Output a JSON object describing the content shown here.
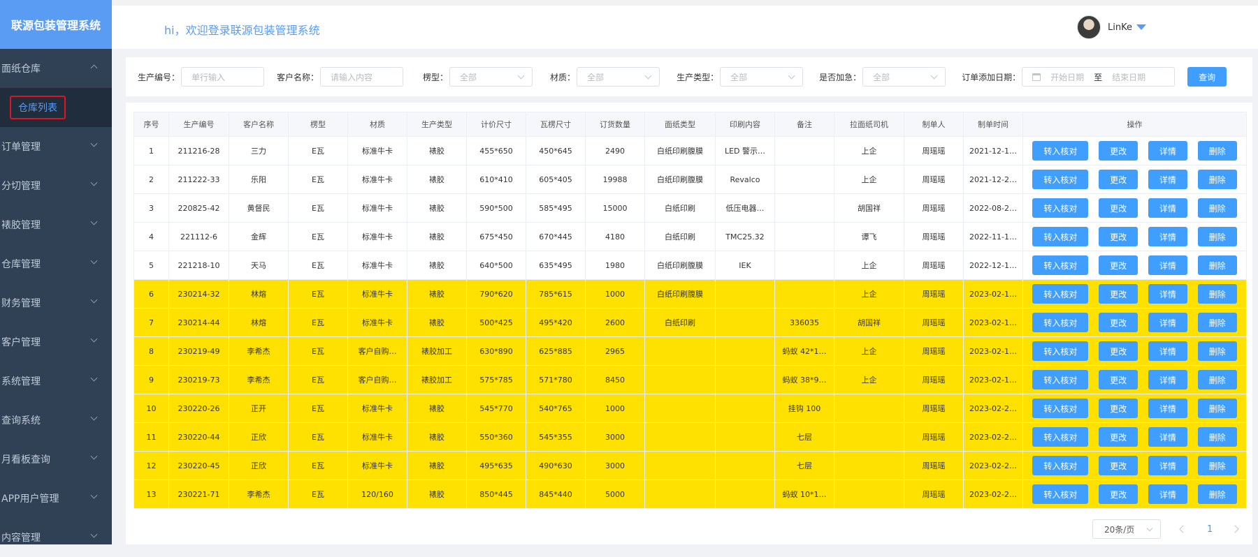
{
  "app": {
    "title": "联源包装管理系统"
  },
  "header": {
    "welcome": "hi，欢迎登录联源包装管理系统",
    "username": "LinKe"
  },
  "sidebar": {
    "open_group": "面纸仓库",
    "active_item": "仓库列表",
    "groups": [
      "订单管理",
      "分切管理",
      "裱胶管理",
      "仓库管理",
      "财务管理",
      "客户管理",
      "系统管理",
      "查询系统",
      "月看板查询",
      "APP用户管理",
      "内容管理"
    ]
  },
  "filters": {
    "prod_no_label": "生产编号：",
    "prod_no_placeholder": "单行输入",
    "customer_label": "客户名称：",
    "customer_placeholder": "请输入内容",
    "flute_label": "楞型：",
    "flute_value": "全部",
    "material_label": "材质：",
    "material_value": "全部",
    "prod_type_label": "生产类型：",
    "prod_type_value": "全部",
    "urgent_label": "是否加急：",
    "urgent_value": "全部",
    "date_label": "订单添加日期：",
    "start_placeholder": "开始日期",
    "to": "至",
    "end_placeholder": "结束日期",
    "query_label": "查询"
  },
  "table": {
    "headers": [
      "序号",
      "生产编号",
      "客户名称",
      "楞型",
      "材质",
      "生产类型",
      "计价尺寸",
      "瓦楞尺寸",
      "订货数量",
      "面纸类型",
      "印刷内容",
      "备注",
      "拉面纸司机",
      "制单人",
      "制单时间",
      "操作"
    ],
    "actions": [
      "转入核对",
      "更改",
      "详情",
      "删除"
    ],
    "rows": [
      {
        "hl": false,
        "cells": [
          "1",
          "211216-28",
          "三力",
          "E瓦",
          "标准牛卡",
          "裱胶",
          "455*650",
          "450*645",
          "2490",
          "白纸印刷腹膜",
          "LED 警示…",
          "",
          "上企",
          "周瑶瑶",
          "2021-12-1…"
        ]
      },
      {
        "hl": false,
        "cells": [
          "2",
          "211222-33",
          "乐阳",
          "E瓦",
          "标准牛卡",
          "裱胶",
          "610*410",
          "605*405",
          "19988",
          "白纸印刷腹膜",
          "Revalco",
          "",
          "上企",
          "周瑶瑶",
          "2021-12-2…"
        ]
      },
      {
        "hl": false,
        "cells": [
          "3",
          "220825-42",
          "黄督民",
          "E瓦",
          "标准牛卡",
          "裱胶",
          "590*500",
          "585*495",
          "15000",
          "白纸印刷",
          "低压电器…",
          "",
          "胡国祥",
          "周瑶瑶",
          "2022-08-2…"
        ]
      },
      {
        "hl": false,
        "cells": [
          "4",
          "221112-6",
          "金辉",
          "E瓦",
          "标准牛卡",
          "裱胶",
          "675*450",
          "670*445",
          "4180",
          "白纸印刷",
          "TMC25.32",
          "",
          "谭飞",
          "周瑶瑶",
          "2022-11-1…"
        ]
      },
      {
        "hl": false,
        "cells": [
          "5",
          "221218-10",
          "天马",
          "E瓦",
          "标准牛卡",
          "裱胶",
          "640*500",
          "635*495",
          "1980",
          "白纸印刷腹膜",
          "IEK",
          "",
          "上企",
          "周瑶瑶",
          "2022-12-1…"
        ]
      },
      {
        "hl": true,
        "cells": [
          "6",
          "230214-32",
          "林熔",
          "E瓦",
          "标准牛卡",
          "裱胶",
          "790*620",
          "785*615",
          "1000",
          "白纸印刷腹膜",
          "",
          "",
          "上企",
          "周瑶瑶",
          "2023-02-1…"
        ]
      },
      {
        "hl": true,
        "cells": [
          "7",
          "230214-44",
          "林熔",
          "E瓦",
          "标准牛卡",
          "裱胶",
          "500*425",
          "495*420",
          "2600",
          "白纸印刷",
          "",
          "336035",
          "胡国祥",
          "周瑶瑶",
          "2023-02-1…"
        ]
      },
      {
        "hl": true,
        "cells": [
          "8",
          "230219-49",
          "李希杰",
          "E瓦",
          "客户自购…",
          "裱胶加工",
          "630*890",
          "625*885",
          "2965",
          "",
          "",
          "蚂蚁 42*1…",
          "上企",
          "周瑶瑶",
          "2023-02-1…"
        ]
      },
      {
        "hl": true,
        "cells": [
          "9",
          "230219-73",
          "李希杰",
          "E瓦",
          "客户自购…",
          "裱胶加工",
          "575*785",
          "571*780",
          "8450",
          "",
          "",
          "蚂蚁 38*9…",
          "上企",
          "周瑶瑶",
          "2023-02-1…"
        ]
      },
      {
        "hl": true,
        "cells": [
          "10",
          "230220-26",
          "正开",
          "E瓦",
          "标准牛卡",
          "裱胶",
          "545*770",
          "540*765",
          "1000",
          "",
          "",
          "挂钩 100",
          "",
          "周瑶瑶",
          "2023-02-2…"
        ]
      },
      {
        "hl": true,
        "cells": [
          "11",
          "230220-44",
          "正欣",
          "E瓦",
          "标准牛卡",
          "裱胶",
          "550*360",
          "545*355",
          "3000",
          "",
          "",
          "七层",
          "",
          "周瑶瑶",
          "2023-02-2…"
        ]
      },
      {
        "hl": true,
        "cells": [
          "12",
          "230220-45",
          "正欣",
          "E瓦",
          "标准牛卡",
          "裱胶",
          "495*635",
          "490*630",
          "3000",
          "",
          "",
          "七层",
          "",
          "周瑶瑶",
          "2023-02-2…"
        ]
      },
      {
        "hl": true,
        "cells": [
          "13",
          "230221-71",
          "李希杰",
          "E瓦",
          "120/160",
          "裱胶",
          "850*445",
          "845*440",
          "5000",
          "",
          "",
          "蚂蚁 10*1…",
          "",
          "周瑶瑶",
          "2023-02-2…"
        ]
      }
    ]
  },
  "pagination": {
    "page_size": "20条/页",
    "current_page": "1"
  },
  "colors": {
    "accent": "#409eff",
    "brand_bg": "#5a9bf4",
    "sidebar_bg": "#304156",
    "highlight_row": "#ffe100",
    "active_outline": "#e0141e"
  }
}
